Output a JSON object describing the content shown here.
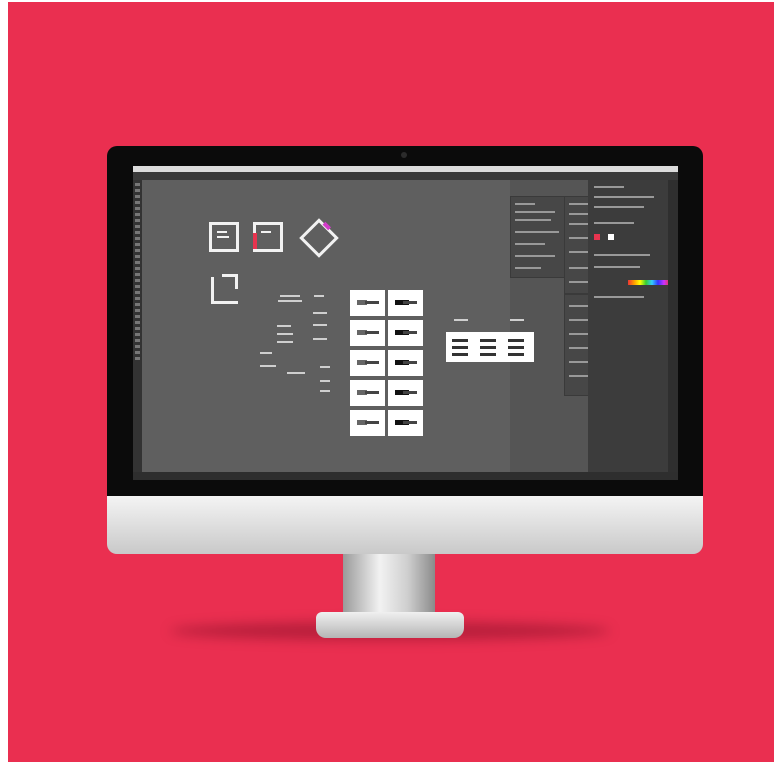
{
  "colors": {
    "background": "#ea2f50",
    "bezel": "#0b0b0b",
    "artboard": "#5f5f5f",
    "accent_red": "#e8344f"
  },
  "device": {
    "type": "desktop-monitor",
    "app": "vector-design-editor"
  },
  "icons": {
    "logo_square_1": "square-logo-mark",
    "logo_square_2": "square-logo-mark-red",
    "logo_diamond": "diamond-logo-mark",
    "logo_bracket": "bracket-logo-mark"
  },
  "cards": {
    "count": 10
  }
}
